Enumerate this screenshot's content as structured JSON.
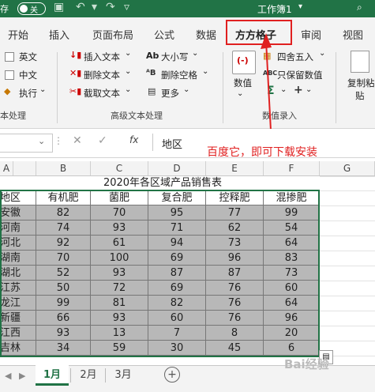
{
  "titlebar": {
    "autosave": "存",
    "toggle_label": "关",
    "workbook": "工作簿1",
    "bg": "#217346"
  },
  "tabs": [
    "开始",
    "插入",
    "页面布局",
    "公式",
    "数据",
    "方方格子",
    "审阅",
    "视图"
  ],
  "active_tab": "方方格子",
  "ribbon": {
    "left_group": {
      "items": [
        "英文",
        "中文",
        "执行"
      ],
      "label": "本处理"
    },
    "advanced_group": {
      "items": [
        "插入文本",
        "删除文本",
        "截取文本",
        "大小写",
        "删除空格",
        "更多"
      ],
      "label": "高级文本处理"
    },
    "record_group": {
      "big_button": "数值",
      "items": [
        "四舍五入",
        "只保留数值"
      ],
      "label": "数值录入"
    },
    "right_button": {
      "line1": "复制粘",
      "line2": "贴"
    }
  },
  "formula_bar": {
    "fx": "fx",
    "value": "地区"
  },
  "annotation": "百度它，即可下载安装",
  "columns": [
    "A",
    "B",
    "C",
    "D",
    "E",
    "F",
    "G"
  ],
  "table": {
    "title": "2020年各区域产品销售表",
    "headers": [
      "地区",
      "有机肥",
      "菌肥",
      "复合肥",
      "控释肥",
      "混掺肥"
    ],
    "rows": [
      [
        "安徽",
        "82",
        "70",
        "95",
        "77",
        "99"
      ],
      [
        "河南",
        "74",
        "93",
        "71",
        "62",
        "54"
      ],
      [
        "河北",
        "92",
        "61",
        "94",
        "73",
        "64"
      ],
      [
        "湖南",
        "70",
        "100",
        "69",
        "96",
        "83"
      ],
      [
        "湖北",
        "52",
        "93",
        "87",
        "87",
        "73"
      ],
      [
        "江苏",
        "50",
        "72",
        "69",
        "76",
        "60"
      ],
      [
        "龙江",
        "99",
        "81",
        "82",
        "76",
        "64"
      ],
      [
        "新疆",
        "66",
        "93",
        "60",
        "76",
        "96"
      ],
      [
        "江西",
        "93",
        "13",
        "7",
        "8",
        "20"
      ],
      [
        "吉林",
        "34",
        "59",
        "30",
        "45",
        "6"
      ]
    ]
  },
  "sheets": [
    "1月",
    "2月",
    "3月"
  ],
  "active_sheet": "1月",
  "watermark": "Bai经验",
  "accent": "#217346",
  "highlight": "#e02020"
}
